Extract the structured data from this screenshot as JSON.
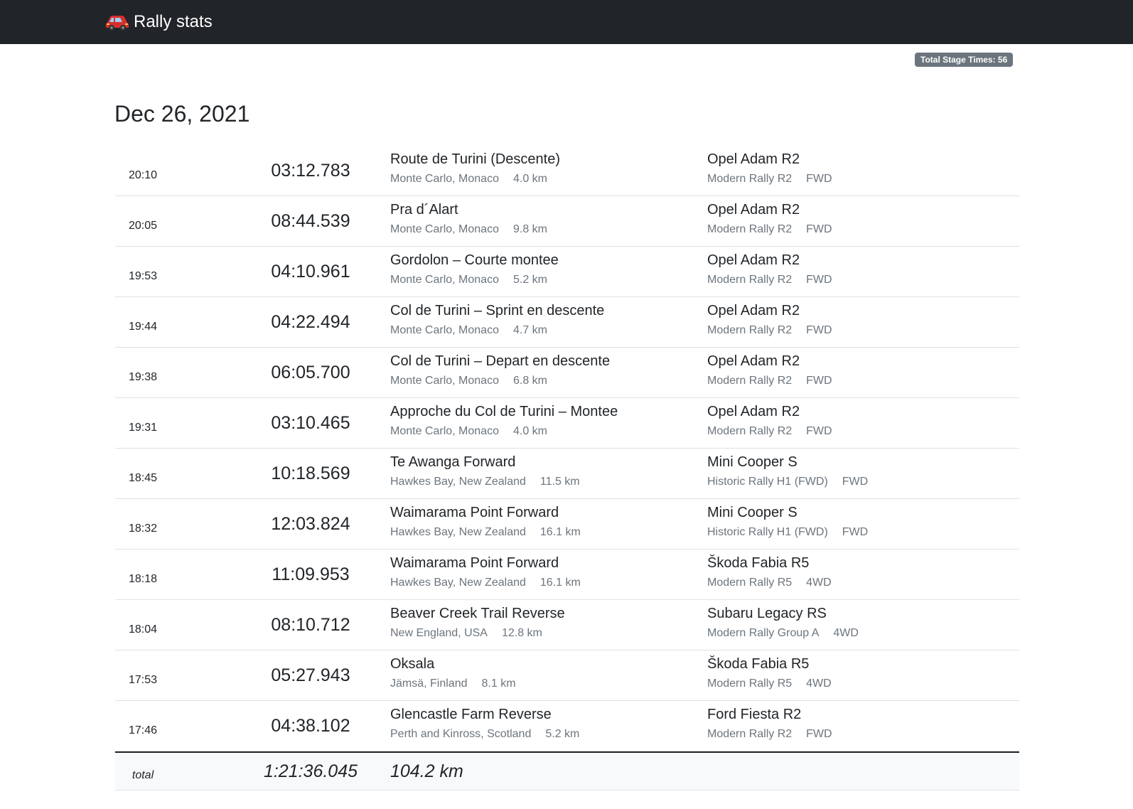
{
  "app": {
    "title": "Rally stats",
    "logo_icon": "red-car-icon"
  },
  "badge": {
    "label": "Total Stage Times: 56"
  },
  "date": "Dec 26, 2021",
  "colors": {
    "navbar": "#212529",
    "muted": "#6c757d",
    "badge": "#6c757d",
    "total_bg": "#f8f9fa"
  },
  "runs": [
    {
      "time": "20:10",
      "duration": "03:12.783",
      "stage": "Route de Turini (Descente)",
      "location": "Monte Carlo, Monaco",
      "distance": "4.0 km",
      "car": "Opel Adam R2",
      "car_class": "Modern Rally R2",
      "drivetrain": "FWD"
    },
    {
      "time": "20:05",
      "duration": "08:44.539",
      "stage": "Pra d´Alart",
      "location": "Monte Carlo, Monaco",
      "distance": "9.8 km",
      "car": "Opel Adam R2",
      "car_class": "Modern Rally R2",
      "drivetrain": "FWD"
    },
    {
      "time": "19:53",
      "duration": "04:10.961",
      "stage": "Gordolon – Courte montee",
      "location": "Monte Carlo, Monaco",
      "distance": "5.2 km",
      "car": "Opel Adam R2",
      "car_class": "Modern Rally R2",
      "drivetrain": "FWD"
    },
    {
      "time": "19:44",
      "duration": "04:22.494",
      "stage": "Col de Turini – Sprint en descente",
      "location": "Monte Carlo, Monaco",
      "distance": "4.7 km",
      "car": "Opel Adam R2",
      "car_class": "Modern Rally R2",
      "drivetrain": "FWD"
    },
    {
      "time": "19:38",
      "duration": "06:05.700",
      "stage": "Col de Turini – Depart en descente",
      "location": "Monte Carlo, Monaco",
      "distance": "6.8 km",
      "car": "Opel Adam R2",
      "car_class": "Modern Rally R2",
      "drivetrain": "FWD"
    },
    {
      "time": "19:31",
      "duration": "03:10.465",
      "stage": "Approche du Col de Turini – Montee",
      "location": "Monte Carlo, Monaco",
      "distance": "4.0 km",
      "car": "Opel Adam R2",
      "car_class": "Modern Rally R2",
      "drivetrain": "FWD"
    },
    {
      "time": "18:45",
      "duration": "10:18.569",
      "stage": "Te Awanga Forward",
      "location": "Hawkes Bay, New Zealand",
      "distance": "11.5 km",
      "car": "Mini Cooper S",
      "car_class": "Historic Rally H1 (FWD)",
      "drivetrain": "FWD"
    },
    {
      "time": "18:32",
      "duration": "12:03.824",
      "stage": "Waimarama Point Forward",
      "location": "Hawkes Bay, New Zealand",
      "distance": "16.1 km",
      "car": "Mini Cooper S",
      "car_class": "Historic Rally H1 (FWD)",
      "drivetrain": "FWD"
    },
    {
      "time": "18:18",
      "duration": "11:09.953",
      "stage": "Waimarama Point Forward",
      "location": "Hawkes Bay, New Zealand",
      "distance": "16.1 km",
      "car": "Škoda Fabia R5",
      "car_class": "Modern Rally R5",
      "drivetrain": "4WD"
    },
    {
      "time": "18:04",
      "duration": "08:10.712",
      "stage": "Beaver Creek Trail Reverse",
      "location": "New England, USA",
      "distance": "12.8 km",
      "car": "Subaru Legacy RS",
      "car_class": "Modern Rally Group A",
      "drivetrain": "4WD"
    },
    {
      "time": "17:53",
      "duration": "05:27.943",
      "stage": "Oksala",
      "location": "Jämsä, Finland",
      "distance": "8.1 km",
      "car": "Škoda Fabia R5",
      "car_class": "Modern Rally R5",
      "drivetrain": "4WD"
    },
    {
      "time": "17:46",
      "duration": "04:38.102",
      "stage": "Glencastle Farm Reverse",
      "location": "Perth and Kinross, Scotland",
      "distance": "5.2 km",
      "car": "Ford Fiesta R2",
      "car_class": "Modern Rally R2",
      "drivetrain": "FWD"
    }
  ],
  "total": {
    "label": "total",
    "duration": "1:21:36.045",
    "distance": "104.2 km"
  }
}
